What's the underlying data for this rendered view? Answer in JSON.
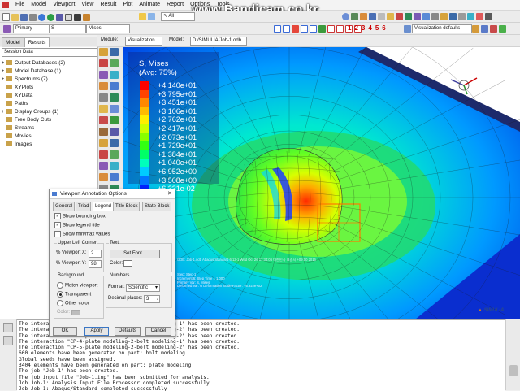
{
  "menu": [
    "File",
    "Model",
    "Viewport",
    "View",
    "Result",
    "Plot",
    "Animate",
    "Report",
    "Options",
    "Tools"
  ],
  "watermark": "www.Bandicam.co.kr",
  "toolbar": {
    "primary": "Primary",
    "variable": "S",
    "invariant": "Mises",
    "all_select": "All",
    "visualization_defaults": "Visualization defaults",
    "num_buttons": [
      "1",
      "2",
      "3",
      "4",
      "5",
      "6"
    ]
  },
  "context": {
    "module_label": "Module:",
    "module_value": "Visualization",
    "model_label": "Model:",
    "model_value": "D:/SIMULIA/Job-1.odb"
  },
  "tabs": [
    "Model",
    "Results"
  ],
  "session": "Session Data",
  "tree": [
    {
      "label": "Output Databases (2)",
      "exp": "+"
    },
    {
      "label": "Model Database (1)",
      "exp": "+"
    },
    {
      "label": "Spectrums (7)",
      "exp": "+"
    },
    {
      "label": "XYPlots",
      "exp": ""
    },
    {
      "label": "XYData",
      "exp": ""
    },
    {
      "label": "Paths",
      "exp": ""
    },
    {
      "label": "Display Groups (1)",
      "exp": "+"
    },
    {
      "label": "Free Body Cuts",
      "exp": ""
    },
    {
      "label": "Streams",
      "exp": ""
    },
    {
      "label": "Movies",
      "exp": ""
    },
    {
      "label": "Images",
      "exp": ""
    }
  ],
  "legend": {
    "title1": "S, Mises",
    "title2": "(Avg: 75%)",
    "entries": [
      {
        "v": "+4.140e+01",
        "c": "#ff0000"
      },
      {
        "v": "+3.795e+01",
        "c": "#ff4400"
      },
      {
        "v": "+3.451e+01",
        "c": "#ff8800"
      },
      {
        "v": "+3.106e+01",
        "c": "#ffbb00"
      },
      {
        "v": "+2.762e+01",
        "c": "#ffee00"
      },
      {
        "v": "+2.417e+01",
        "c": "#ccff00"
      },
      {
        "v": "+2.073e+01",
        "c": "#88ff00"
      },
      {
        "v": "+1.729e+01",
        "c": "#33ff11"
      },
      {
        "v": "+1.384e+01",
        "c": "#00ff66"
      },
      {
        "v": "+1.040e+01",
        "c": "#00ffbb"
      },
      {
        "v": "+6.952e+00",
        "c": "#00ccff"
      },
      {
        "v": "+3.508e+00",
        "c": "#0077ff"
      },
      {
        "v": "+6.331e-02",
        "c": "#0022ff"
      }
    ]
  },
  "viewport_info": {
    "line1": "ODB: Job-1.odb    Abaqus/Standard 6.13-1    Wed Oct 26 17:34:06 대한민국 표준시 +09:00 2016",
    "line2": "Step: Step-1",
    "line3": "Increment     6: Step Time =    1.000",
    "line4": "Primary Var: S, Mises",
    "line5": "Deformed Var: U   Deformation Scale Factor: +6.922e+02"
  },
  "simulia": "SIMULIA",
  "dialog": {
    "title": "Viewport Annotation Options",
    "tabs": [
      "General",
      "Triad",
      "Legend",
      "Title Block",
      "State Block"
    ],
    "active_tab": "Legend",
    "show_bounding_box": "Show bounding box",
    "show_legend_title": "Show legend title",
    "show_minmax": "Show min/max values",
    "upper_left_corner": "Upper Left Corner",
    "vx_label": "% Viewport X:",
    "vx_value": "2",
    "vy_label": "% Viewport Y:",
    "vy_value": "98",
    "text_group": "Text",
    "set_font": "Set Font...",
    "color_label": "Color:",
    "background_group": "Background",
    "match_viewport": "Match viewport",
    "transparent": "Transparent",
    "other_color": "Other color",
    "color2_label": "Color:",
    "numbers_group": "Numbers",
    "format_label": "Format:",
    "format_value": "Scientific",
    "decimal_label": "Decimal places:",
    "decimal_value": "3",
    "ok": "OK",
    "apply": "Apply",
    "defaults": "Defaults",
    "cancel": "Cancel"
  },
  "messages": [
    "The interaction \"CP-1-plate modeling-1-bolt modeling-1\" has been created.",
    "The interaction \"CP-2-plate modeling-1-bolt modeling-2\" has been created.",
    "The interaction \"CP-3-plate modeling-2-bolt modeling-2\" has been created.",
    "The interaction \"CP-4-plate modeling-2-bolt modeling-1\" has been created.",
    "The interaction \"CP-5-plate modeling-2-bolt modeling-2\" has been created.",
    "660 elements have been generated on part: bolt modeling",
    "Global seeds have been assigned.",
    "3404 elements have been generated on part: plate modeling",
    "The job \"Job-1\" has been created.",
    "The job input file \"Job-1.inp\" has been submitted for analysis.",
    "Job Job-1: Analysis Input File Processor completed successfully.",
    "Job Job-1: Abaqus/Standard completed successfully",
    "Job Job-1 completed successfully."
  ]
}
